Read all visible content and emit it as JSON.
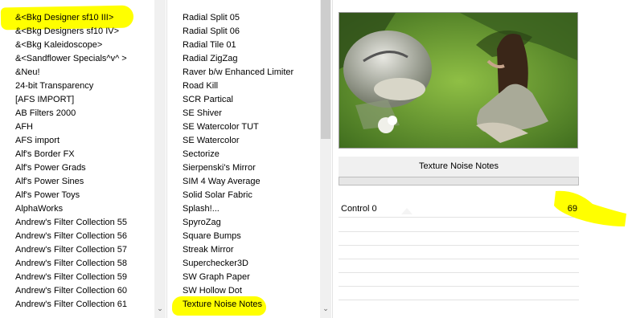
{
  "left_list": {
    "items": [
      "&<Bkg Designer sf10 III>",
      "&<Bkg Designers sf10 IV>",
      "&<Bkg Kaleidoscope>",
      "&<Sandflower Specials^v^ >",
      "&Neu!",
      "24-bit Transparency",
      "[AFS IMPORT]",
      "AB Filters 2000",
      "AFH",
      "AFS import",
      "Alf's Border FX",
      "Alf's Power Grads",
      "Alf's Power Sines",
      "Alf's Power Toys",
      "AlphaWorks",
      "Andrew's Filter Collection 55",
      "Andrew's Filter Collection 56",
      "Andrew's Filter Collection 57",
      "Andrew's Filter Collection 58",
      "Andrew's Filter Collection 59",
      "Andrew's Filter Collection 60",
      "Andrew's Filter Collection 61"
    ],
    "selected": "&<Bkg Designer sf10 III>"
  },
  "middle_list": {
    "items": [
      "Radial Split 05",
      "Radial Split 06",
      "Radial Tile 01",
      "Radial ZigZag",
      "Raver b/w Enhanced Limiter",
      "Road Kill",
      "SCR  Partical",
      "SE Shiver",
      "SE Watercolor TUT",
      "SE Watercolor",
      "Sectorize",
      "Sierpenski's Mirror",
      "SIM 4 Way Average",
      "Solid Solar Fabric",
      "Splash!...",
      "SpyroZag",
      "Square Bumps",
      "Streak Mirror",
      "Superchecker3D",
      "SW Graph Paper",
      "SW Hollow Dot",
      "Texture Noise Notes"
    ],
    "selected": "Texture Noise Notes"
  },
  "filter_panel": {
    "title": "Texture Noise Notes",
    "controls": [
      {
        "label": "Control 0",
        "value": "69"
      }
    ]
  },
  "colors": {
    "highlight": "#ffff00",
    "scrollbar_thumb": "#cdcdcd",
    "panel_bg": "#f0f0f0"
  },
  "icons": {
    "scroll_down": "chevron-down-icon"
  }
}
